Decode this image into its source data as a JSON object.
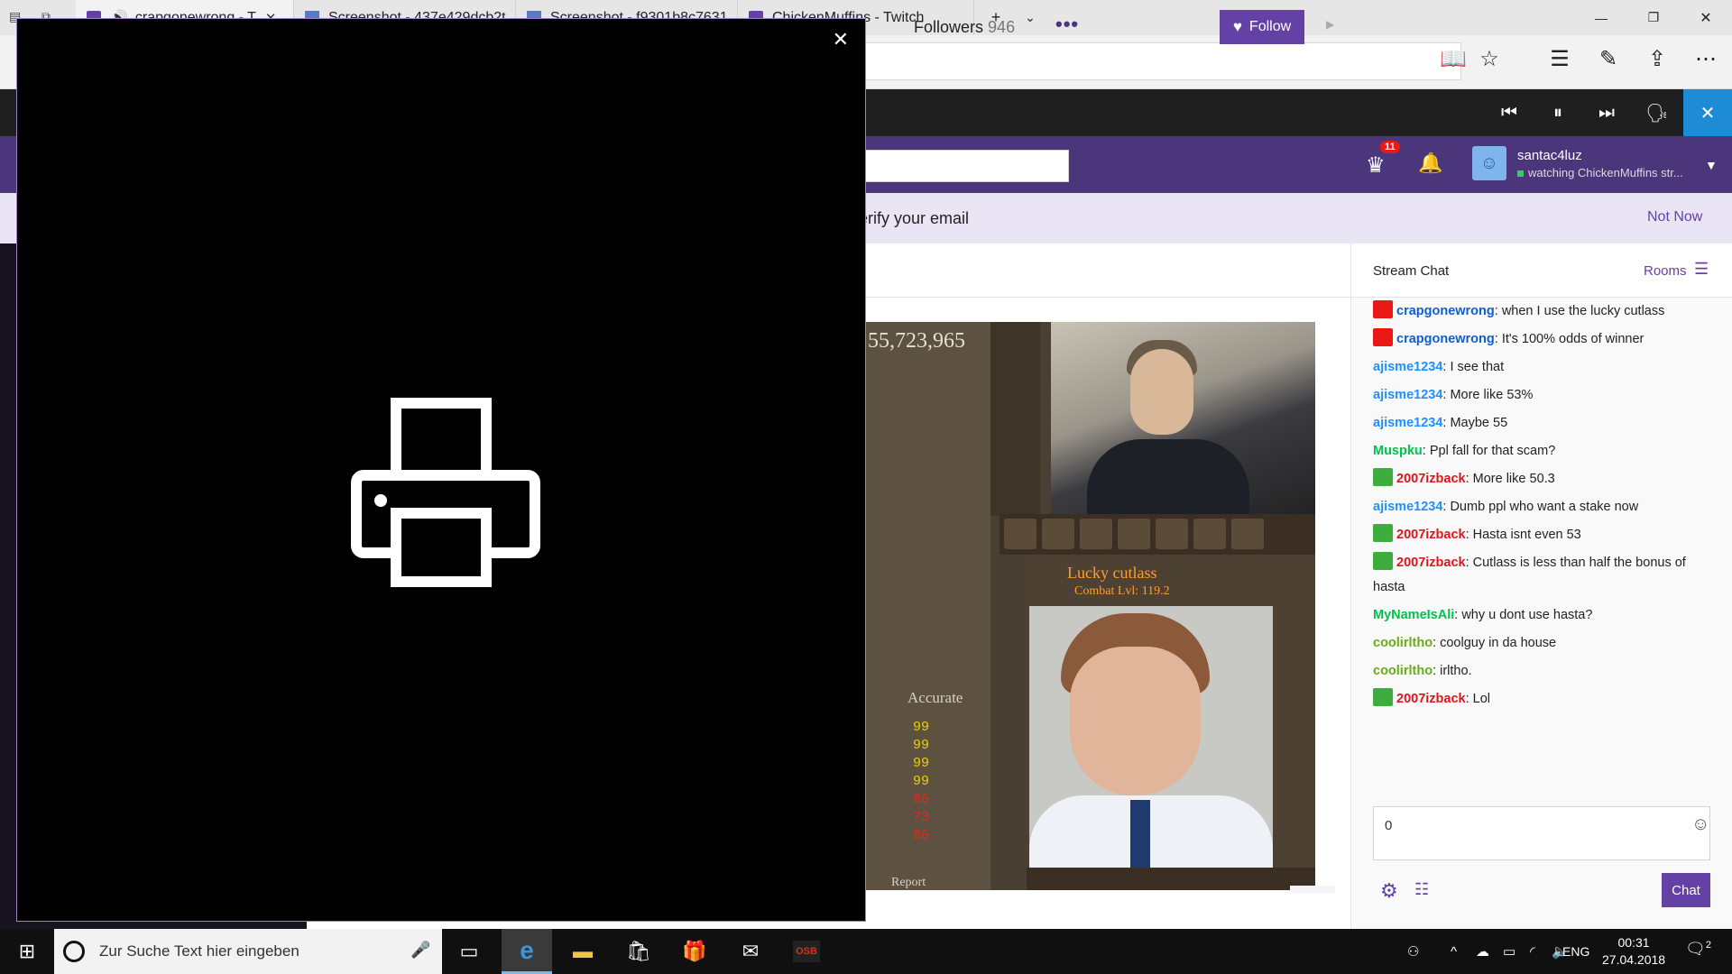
{
  "browser": {
    "tabs": [
      {
        "label": "crapgonewrong - T",
        "favicon": "twitch",
        "active": true
      },
      {
        "label": "Screenshot - 437e429dcb2t",
        "favicon": "screenshot",
        "active": false
      },
      {
        "label": "Screenshot - f9301b8c7631",
        "favicon": "screenshot",
        "active": false
      },
      {
        "label": "ChickenMuffins - Twitch",
        "favicon": "twitch",
        "active": false
      }
    ],
    "new_tab": "+",
    "tab_list": "⌄",
    "window_controls": {
      "minimize": "—",
      "restore": "❐",
      "close": "✕"
    },
    "address_icons": [
      "reading-view-icon",
      "favorite-star-icon",
      "favorites-hub-icon",
      "pen-icon",
      "share-icon",
      "more-icon"
    ]
  },
  "media_bar": {
    "prev": "⏮",
    "pause": "⏸",
    "next": "⏭",
    "voice": "🗣",
    "close": "✕"
  },
  "twitch_nav": {
    "crown_badge": "11",
    "user_name": "santac4luz",
    "user_status": "watching ChickenMuffins str..."
  },
  "verify_banner": {
    "text": "erify your email",
    "dismiss": "Not Now"
  },
  "channel": {
    "followers_label": "Followers",
    "followers_count": "946",
    "more": "•••",
    "follow_label": "Follow"
  },
  "video": {
    "xp_counter": "55,723,965",
    "item_name": "Lucky cutlass",
    "combat_level": "Combat Lvl: 119.2",
    "attack_style": "Accurate",
    "report": "Report",
    "skill_levels": [
      {
        "value": "99",
        "color": "#e6d400"
      },
      {
        "value": "99",
        "color": "#e6d400"
      },
      {
        "value": "99",
        "color": "#e6d400"
      },
      {
        "value": "99",
        "color": "#e6d400"
      },
      {
        "value": "86",
        "color": "#e02b20"
      },
      {
        "value": "73",
        "color": "#e02b20"
      },
      {
        "value": "86",
        "color": "#e02b20"
      }
    ]
  },
  "chat": {
    "title": "Stream Chat",
    "rooms": "Rooms",
    "messages": [
      {
        "user": "crapgonewrong",
        "color": "#0e5ed1",
        "badge": "cam",
        "text": ": when I use the lucky cutlass"
      },
      {
        "user": "crapgonewrong",
        "color": "#0e5ed1",
        "badge": "cam",
        "text": ": It's 100% odds of winner"
      },
      {
        "user": "ajisme1234",
        "color": "#1e90ff",
        "badge": "",
        "text": ": I see that"
      },
      {
        "user": "ajisme1234",
        "color": "#1e90ff",
        "badge": "",
        "text": ": More like 53%"
      },
      {
        "user": "ajisme1234",
        "color": "#1e90ff",
        "badge": "",
        "text": ": Maybe 55"
      },
      {
        "user": "Muspku",
        "color": "#00c24c",
        "badge": "",
        "text": ": Ppl fall for that scam?"
      },
      {
        "user": "2007izback",
        "color": "#e0151b",
        "badge": "sword",
        "text": ": More like 50.3"
      },
      {
        "user": "ajisme1234",
        "color": "#1e90ff",
        "badge": "",
        "text": ": Dumb ppl who want a stake now"
      },
      {
        "user": "2007izback",
        "color": "#e0151b",
        "badge": "sword",
        "text": ": Hasta isnt even 53"
      },
      {
        "user": "2007izback",
        "color": "#e0151b",
        "badge": "sword",
        "text": ": Cutlass is less than half the bonus of hasta"
      },
      {
        "user": "MyNameIsAli",
        "color": "#00c24c",
        "badge": "",
        "text": ": why u dont use hasta?"
      },
      {
        "user": "coolirltho",
        "color": "#6aab17",
        "badge": "",
        "text": ": coolguy in da house"
      },
      {
        "user": "coolirltho",
        "color": "#6aab17",
        "badge": "",
        "text": ": irltho."
      },
      {
        "user": "2007izback",
        "color": "#e0151b",
        "badge": "sword",
        "text": ": Lol"
      }
    ],
    "input_value": "0",
    "send_label": "Chat"
  },
  "overlay": {
    "close": "✕"
  },
  "taskbar": {
    "search_placeholder": "Zur Suche Text hier eingeben",
    "lang": "ENG",
    "time": "00:31",
    "date": "27.04.2018",
    "notifications": "2"
  }
}
